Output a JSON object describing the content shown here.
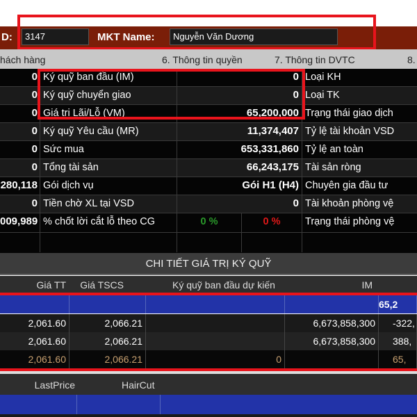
{
  "header": {
    "id_label": "D:",
    "id_value": "3147",
    "mkt_label": "MKT Name:",
    "mkt_value": "Nguyễn Văn Dương"
  },
  "tabs": [
    "hách hàng",
    "6. Thông tin quyền",
    "7. Thông tin DVTC",
    "8."
  ],
  "rows": [
    {
      "v0": "0",
      "label": "Ký quỹ ban đầu (IM)",
      "value": "0",
      "right": "Loại KH"
    },
    {
      "v0": "0",
      "label": "Ký quỹ chuyển giao",
      "value": "0",
      "right": "Loại TK"
    },
    {
      "v0": "0",
      "label": "Giá trị Lãi/Lỗ (VM)",
      "value": "65,200,000",
      "right": "Trạng thái giao dịch"
    },
    {
      "v0": "0",
      "label": "Ký quỹ Yêu cầu (MR)",
      "value": "11,374,407",
      "right": "Tỷ lệ tài khoản VSD"
    },
    {
      "v0": "0",
      "label": "Sức mua",
      "value": "653,331,860",
      "right": "Tỷ lệ an toàn"
    },
    {
      "v0": "0",
      "label": "Tổng tài sản",
      "value": "66,243,175",
      "right": "Tài sản ròng"
    },
    {
      "v0": "280,118",
      "label": "Gói dịch vụ",
      "value": "Gói H1 (H4)",
      "right": "Chuyên gia đầu tư"
    },
    {
      "v0": "0",
      "label": "Tiền chờ XL tại VSD",
      "value": "0",
      "right": "Tài khoản phòng vệ"
    }
  ],
  "cg_row": {
    "v0": "009,989",
    "label": "% chốt lời cắt lỗ theo CG",
    "profit": "0 %",
    "loss": "0 %",
    "right": "Trạng thái phòng vệ"
  },
  "section_title": "CHI TIẾT GIÁ TRỊ KÝ QUỸ",
  "margin_table": {
    "headers": [
      "Giá TT",
      "Giá TSCS",
      "Ký quỹ ban đầu dự kiến",
      "IM"
    ],
    "summary_last": "65,2",
    "rows": [
      {
        "gia_tt": "2,061.60",
        "gia_tscs": "2,066.21",
        "kq": "",
        "im": "6,673,858,300",
        "last": "-322,"
      },
      {
        "gia_tt": "2,061.60",
        "gia_tscs": "2,066.21",
        "kq": "",
        "im": "6,673,858,300",
        "last": "388,"
      },
      {
        "gia_tt": "2,061.60",
        "gia_tscs": "2,066.21",
        "kq": "0",
        "im": "",
        "last": "65,"
      }
    ]
  },
  "bottom_table": {
    "headers": [
      "LastPrice",
      "HairCut"
    ]
  },
  "colors": {
    "highlight": "#e8141c",
    "header_bar": "#7a1e08",
    "blue_row": "#2233a8",
    "total_text": "#c8a070",
    "green": "#2a9a2a",
    "red": "#e01818"
  }
}
